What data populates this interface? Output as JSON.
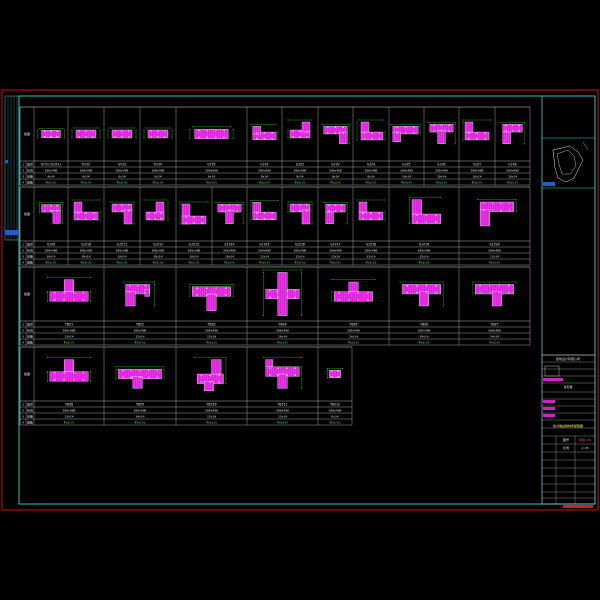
{
  "colors": {
    "background": "#000000",
    "outer_border": "#d01010",
    "inner_border": "#40d0d0",
    "table_lines": "#e0e0e0",
    "wall": "#e020e0",
    "rebar": "#ffffff",
    "dim": "#30e030",
    "accent": "#ffff40"
  },
  "rows": [
    {
      "label": "截面",
      "cols": [
        {
          "shape": "bar",
          "name": "GYZ1(GJZ1)",
          "sub": "200x400",
          "n": "4x14"
        },
        {
          "shape": "bar",
          "name": "GYZ2",
          "sub": "200x400",
          "n": "6x14"
        },
        {
          "shape": "bar",
          "name": "GYZ3",
          "sub": "200x400",
          "n": "6x14"
        },
        {
          "shape": "bar",
          "name": "GYZ4",
          "sub": "200x400",
          "n": "6x14"
        },
        {
          "shape": "barlong",
          "name": "GYZ5",
          "sub": "200x600",
          "n": "8x14"
        },
        {
          "shape": "Lr",
          "name": "GJZ1",
          "sub": "200x400",
          "n": "8x14"
        },
        {
          "shape": "Ll",
          "name": "GJZ2",
          "sub": "200x400",
          "n": "8x14"
        },
        {
          "shape": "Lr2",
          "name": "GJZ3",
          "sub": "200x400",
          "n": "8x14"
        },
        {
          "shape": "Lr3",
          "name": "GJZ4",
          "sub": "200x400",
          "n": "8x14"
        },
        {
          "shape": "Lr4",
          "name": "GJZ5",
          "sub": "200x400",
          "n": "10x14"
        },
        {
          "shape": "Lt",
          "name": "GJZ6",
          "sub": "200x400",
          "n": "10x14"
        },
        {
          "shape": "Lt2",
          "name": "GJZ7",
          "sub": "200x400",
          "n": "10x14"
        },
        {
          "shape": "Lt3",
          "name": "GJZ8",
          "sub": "200x400",
          "n": "10x14"
        }
      ]
    },
    {
      "label": "截面",
      "cols": [
        {
          "shape": "Ld",
          "name": "GJZ9",
          "sub": "200x400",
          "n": "10x14"
        },
        {
          "shape": "Ld2",
          "name": "GJZ10",
          "sub": "200x400",
          "n": "10x14"
        },
        {
          "shape": "Ld3",
          "name": "GJZ11",
          "sub": "200x400",
          "n": "10x14"
        },
        {
          "shape": "Ld4",
          "name": "GJZ12",
          "sub": "200x400",
          "n": "10x14"
        },
        {
          "shape": "Ld5",
          "name": "GJZ13",
          "sub": "200x400",
          "n": "10x14"
        },
        {
          "shape": "Lt",
          "name": "GJZ14",
          "sub": "200x400",
          "n": "10x14"
        },
        {
          "shape": "Lt2",
          "name": "GJZ15",
          "sub": "200x400",
          "n": "12x14"
        },
        {
          "shape": "Ld",
          "name": "GJZ16",
          "sub": "200x400",
          "n": "12x14"
        },
        {
          "shape": "Lt3",
          "name": "GJZ17",
          "sub": "200x400",
          "n": "12x14"
        },
        {
          "shape": "Ld2",
          "name": "GJZ18",
          "sub": "200x400",
          "n": "12x14"
        },
        {
          "shape": "Lt4",
          "name": "GJZ19",
          "sub": "200x400",
          "n": "12x14"
        },
        {
          "shape": "Lt5",
          "name": "GJZ20",
          "sub": "200x400",
          "n": "12x14"
        }
      ]
    },
    {
      "label": "截面",
      "cols": [
        {
          "shape": "T",
          "name": "YBZ1",
          "sub": "200x400",
          "n": "12x14"
        },
        {
          "shape": "T2",
          "name": "YBZ2",
          "sub": "200x400",
          "n": "12x14"
        },
        {
          "shape": "T3",
          "name": "YBZ3",
          "sub": "200x400",
          "n": "12x14"
        },
        {
          "shape": "X",
          "name": "YBZ4",
          "sub": "200x400",
          "n": "16x14"
        },
        {
          "shape": "T4",
          "name": "YBZ5",
          "sub": "200x400",
          "n": "14x14"
        },
        {
          "shape": "T5",
          "name": "YBZ6",
          "sub": "200x400",
          "n": "14x14"
        },
        {
          "shape": "T6",
          "name": "YBZ7",
          "sub": "200x400",
          "n": "14x14"
        }
      ]
    },
    {
      "label": "截面",
      "cols": [
        {
          "shape": "T",
          "name": "YBZ8",
          "sub": "200x400",
          "n": "12x14"
        },
        {
          "shape": "Tl",
          "name": "YBZ9",
          "sub": "200x400",
          "n": "14x14"
        },
        {
          "shape": "Tr",
          "name": "YBZ10",
          "sub": "200x400",
          "n": "12x14"
        },
        {
          "shape": "T7",
          "name": "YBZ11",
          "sub": "200x400",
          "n": "12x14"
        },
        {
          "shape": "sq",
          "name": "YBZ12",
          "sub": "200x400",
          "n": "6x14"
        }
      ]
    }
  ],
  "row_labels": [
    "编号",
    "标高",
    "纵筋",
    "箍筋"
  ],
  "title_block": {
    "company": "建筑设计有限公司",
    "project": "住宅楼",
    "drawing": "剪力墙边缘构件配筋图",
    "drawing_no": "结施-06",
    "scale": "1:25"
  }
}
